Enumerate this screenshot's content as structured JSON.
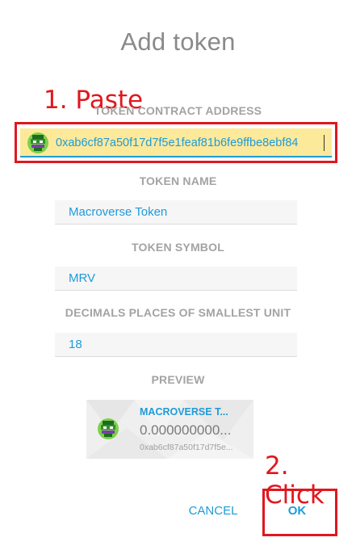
{
  "dialog": {
    "title": "Add token"
  },
  "annotations": {
    "step1": "1. Paste",
    "step2": "2. Click"
  },
  "fields": {
    "contract_address": {
      "label": "TOKEN CONTRACT ADDRESS",
      "value": "0xab6cf87a50f17d7f5e1feaf81b6fe9ffbe8ebf84"
    },
    "token_name": {
      "label": "TOKEN NAME",
      "value": "Macroverse Token"
    },
    "token_symbol": {
      "label": "TOKEN SYMBOL",
      "value": "MRV"
    },
    "decimals": {
      "label": "DECIMALS PLACES OF SMALLEST UNIT",
      "value": "18"
    }
  },
  "preview": {
    "label": "PREVIEW",
    "name": "MACROVERSE T...",
    "balance": "0.000000000...",
    "address": "0xab6cf87a50f17d7f5e..."
  },
  "buttons": {
    "cancel": "CANCEL",
    "ok": "OK"
  },
  "colors": {
    "accent": "#1e9bd9",
    "annotation": "#e0171f",
    "highlight": "#fde99a"
  },
  "icons": {
    "token_avatar": "identicon-icon"
  }
}
